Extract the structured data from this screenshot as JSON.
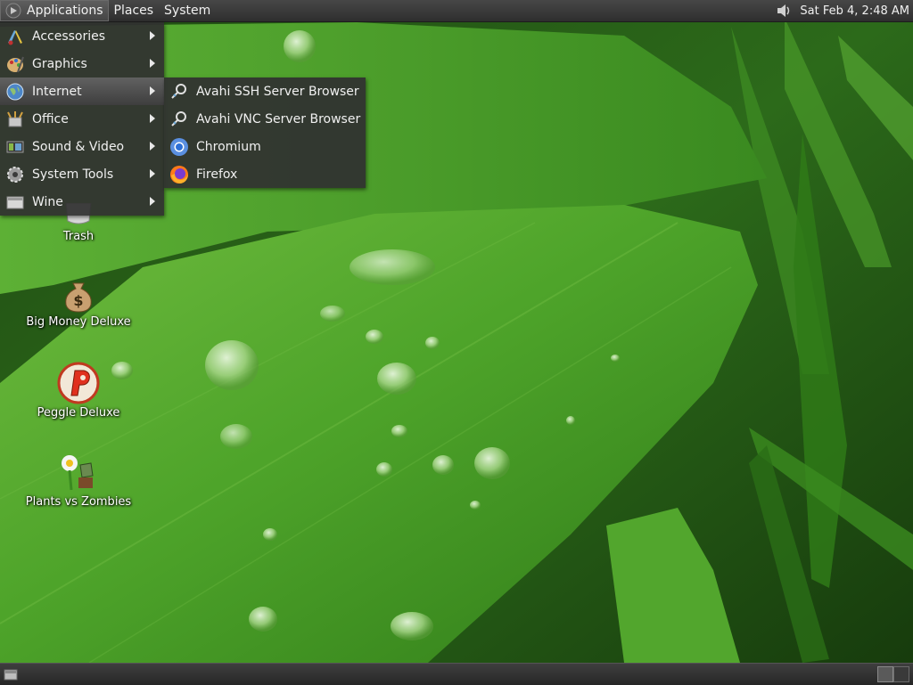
{
  "top_panel": {
    "menus": [
      "Applications",
      "Places",
      "System"
    ],
    "clock": "Sat Feb  4,  2:48 AM",
    "tray_icons": [
      "volume-icon"
    ]
  },
  "applications_menu": {
    "open": true,
    "items": [
      {
        "label": "Accessories",
        "icon": "accessories-icon",
        "has_submenu": true
      },
      {
        "label": "Graphics",
        "icon": "graphics-icon",
        "has_submenu": true
      },
      {
        "label": "Internet",
        "icon": "internet-icon",
        "has_submenu": true,
        "selected": true
      },
      {
        "label": "Office",
        "icon": "office-icon",
        "has_submenu": true
      },
      {
        "label": "Sound & Video",
        "icon": "sound-video-icon",
        "has_submenu": true
      },
      {
        "label": "System Tools",
        "icon": "system-tools-icon",
        "has_submenu": true
      },
      {
        "label": "Wine",
        "icon": "wine-icon",
        "has_submenu": true
      }
    ]
  },
  "internet_submenu": {
    "items": [
      {
        "label": "Avahi SSH Server Browser",
        "icon": "avahi-ssh-icon"
      },
      {
        "label": "Avahi VNC Server Browser",
        "icon": "avahi-vnc-icon"
      },
      {
        "label": "Chromium",
        "icon": "chromium-icon"
      },
      {
        "label": "Firefox",
        "icon": "firefox-icon"
      }
    ]
  },
  "desktop_icons": [
    {
      "label": "Trash",
      "icon": "trash-icon"
    },
    {
      "label": "Big Money Deluxe",
      "icon": "money-bag-icon"
    },
    {
      "label": "Peggle Deluxe",
      "icon": "peggle-icon"
    },
    {
      "label": "Plants vs Zombies",
      "icon": "plants-vs-zombies-icon"
    }
  ],
  "bottom_panel": {
    "icons": [
      "show-desktop-icon",
      "workspace-switcher-icon"
    ]
  },
  "wallpaper": {
    "subject": "green leaf with water droplets",
    "primary_color": "#4a9a2a"
  }
}
